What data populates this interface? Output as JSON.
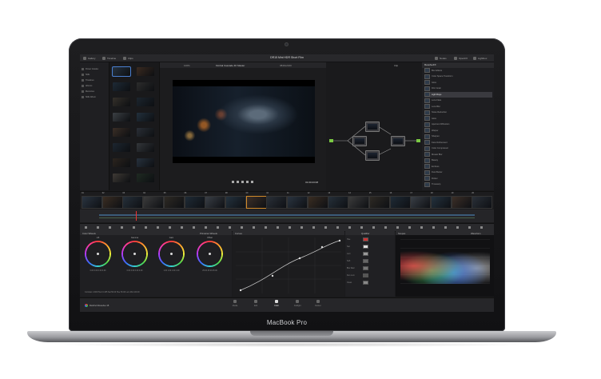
{
  "device": {
    "brand": "MacBook Pro"
  },
  "app": {
    "project_title": "DR15 Mini HDR Short Film",
    "timeline_name": "Kimbal Cascade 4K Master",
    "page_tabs": [
      {
        "label": "Media",
        "icon": "media-icon"
      },
      {
        "label": "Edit",
        "icon": "edit-icon"
      },
      {
        "label": "Color",
        "icon": "color-icon"
      },
      {
        "label": "Fairlight",
        "icon": "fairlight-icon"
      },
      {
        "label": "Deliver",
        "icon": "deliver-icon"
      }
    ],
    "active_page": "Color",
    "app_name": "DaVinci Resolve 15"
  },
  "topbar": {
    "gallery": "Gallery",
    "timeline": "Timeline",
    "clips": "Clips",
    "nodes": "Nodes",
    "openfx": "OpenFX",
    "lightbox": "Lightbox"
  },
  "media_pool": {
    "items": [
      "Power Grades",
      "Stills",
      "Timelines",
      "Albums",
      "Memories",
      "Stills Album"
    ]
  },
  "viewer": {
    "timecode": "01:00:23:08",
    "zoom": "100%",
    "resolution": "3840x2160"
  },
  "nodes": {
    "mode": "Clip"
  },
  "library": {
    "title": "ResolveFX",
    "items": [
      "Blur Effects",
      "Color Space Transform",
      "Glow",
      "Film Grain",
      "Light Rays",
      "Lens Flare",
      "Lens Blur",
      "Noise Reduction",
      "Glow",
      "Aperture Diffraction",
      "Warper",
      "Sharpen",
      "Face Refinement",
      "Color Compressor",
      "Mosaic Blur",
      "Beauty",
      "Emboss",
      "Dust Buster",
      "Flicker",
      "Timewarp"
    ],
    "selected_index": 4
  },
  "clips": {
    "labels": [
      "01",
      "02",
      "03",
      "04",
      "05",
      "06",
      "07",
      "08",
      "09",
      "10",
      "11",
      "12",
      "13",
      "14",
      "15",
      "16",
      "17",
      "18",
      "19",
      "20"
    ]
  },
  "color_wheels": {
    "title": "Color Wheels",
    "mode": "Primaries Wheels",
    "wheels": [
      {
        "label": "Lift",
        "values": "0.00  0.00  0.00  0.00"
      },
      {
        "label": "Gamma",
        "values": "0.00  0.00  0.00  0.00"
      },
      {
        "label": "Gain",
        "values": "1.00  1.00  1.00  1.00"
      },
      {
        "label": "Offset",
        "values": "25.00  25.00  25.00"
      }
    ],
    "footer": "Contrast 1.000   Pivot 0.435   Sat 50.00   Hue 50.00   Lum Mix 100.00"
  },
  "curves": {
    "title": "Curves"
  },
  "qualifier": {
    "title": "Qualifier",
    "rows": [
      "Hue",
      "Sat",
      "Lum",
      "Soft",
      "Blur Rad",
      "Den Lum",
      "Clean"
    ]
  },
  "scope": {
    "title": "Scopes",
    "mode": "Waveform"
  }
}
